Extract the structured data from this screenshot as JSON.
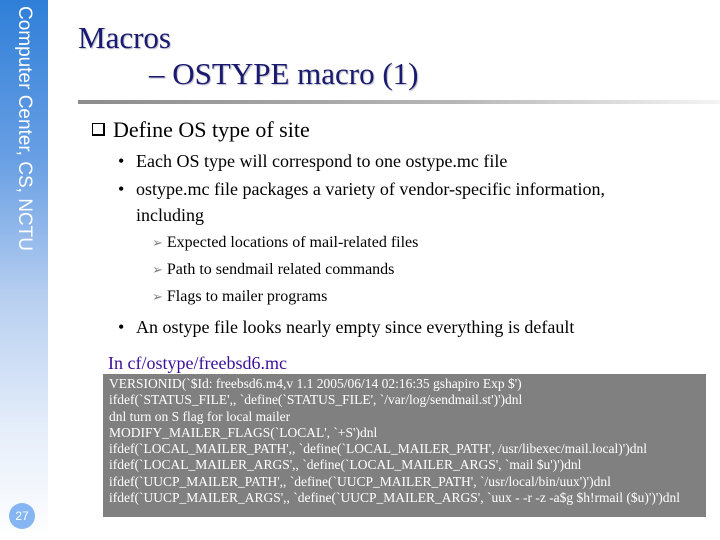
{
  "sidebar": {
    "org_label": "Computer Center, CS, NCTU",
    "page_number": "27"
  },
  "slide": {
    "title_line1": "Macros",
    "title_line2": "– OSTYPE macro (1)",
    "bullets": [
      {
        "level": 1,
        "icon": "checkbox-square-icon",
        "text": "Define OS type of site"
      }
    ],
    "sub_bullets": [
      "Each OS type will correspond to one ostype.mc file",
      "ostype.mc file packages a variety of vendor-specific information,",
      "including"
    ],
    "arrow_items": [
      "Expected locations of mail-related files",
      "Path to sendmail related commands",
      "Flags to mailer programs"
    ],
    "last_bullet": "An ostype file looks nearly empty since everything is default",
    "code_label": "In cf/ostype/freebsd6.mc",
    "code_lines": [
      "VERSIONID(`$Id: freebsd6.m4,v 1.1 2005/06/14 02:16:35 gshapiro Exp $')",
      "ifdef(`STATUS_FILE',, `define(`STATUS_FILE', `/var/log/sendmail.st')')dnl",
      "dnl turn on S flag for local mailer",
      "MODIFY_MAILER_FLAGS(`LOCAL', `+S')dnl",
      "ifdef(`LOCAL_MAILER_PATH',, `define(`LOCAL_MAILER_PATH', /usr/libexec/mail.local)')dnl",
      "ifdef(`LOCAL_MAILER_ARGS',, `define(`LOCAL_MAILER_ARGS', `mail $u')')dnl",
      "ifdef(`UUCP_MAILER_PATH',, `define(`UUCP_MAILER_PATH', `/usr/local/bin/uux')')dnl",
      "ifdef(`UUCP_MAILER_ARGS',, `define(`UUCP_MAILER_ARGS', `uux - -r -z -a$g $h!rmail ($u)')')dnl"
    ]
  }
}
